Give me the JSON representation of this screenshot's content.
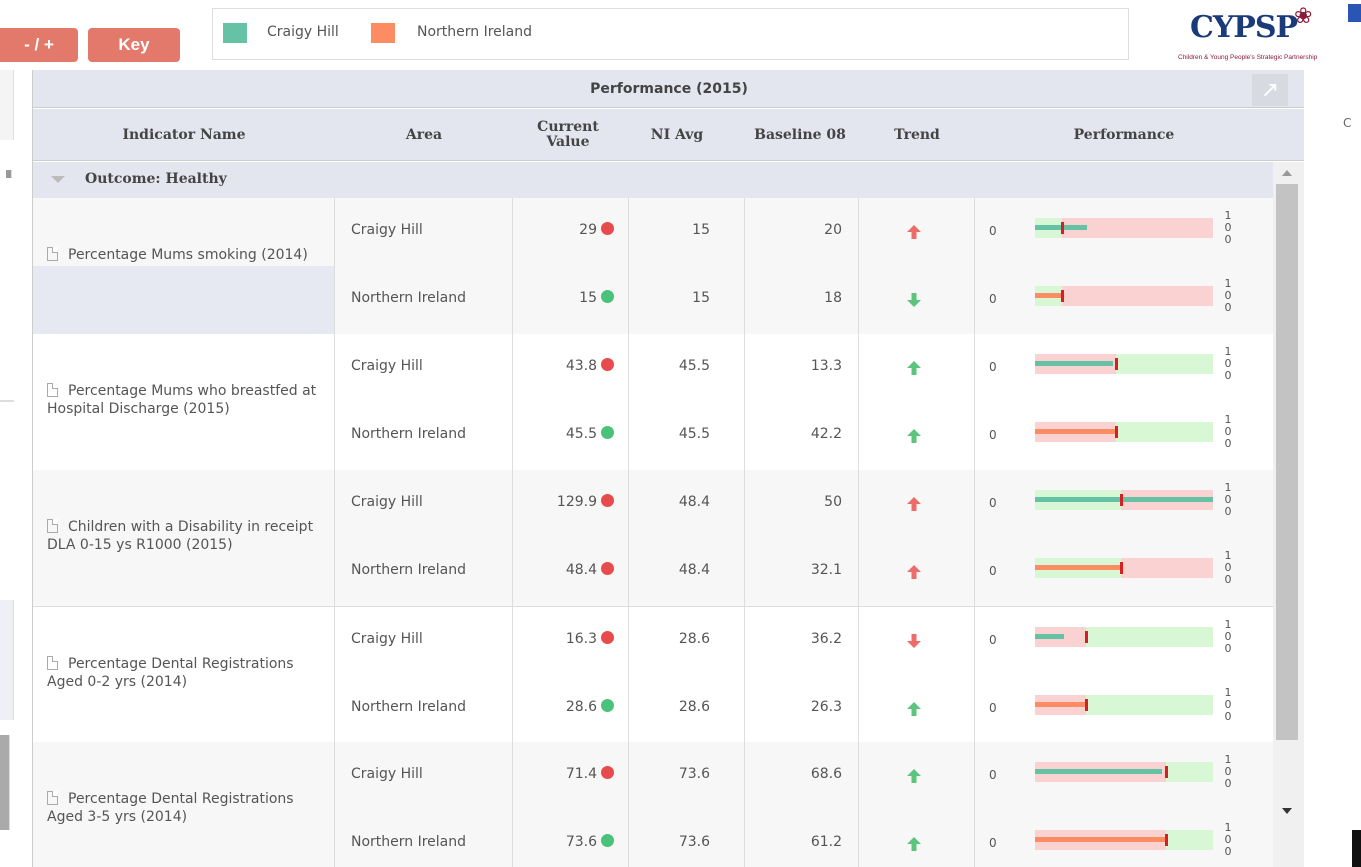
{
  "toolbar": {
    "zoom_label": "- / +",
    "key_label": "Key"
  },
  "legend": [
    {
      "label": "Craigy Hill",
      "color": "#66c2a5"
    },
    {
      "label": "Northern Ireland",
      "color": "#fc8d62"
    }
  ],
  "logo": {
    "text": "CYPSP",
    "subtitle": "Children & Young People's Strategic Partnership"
  },
  "window": {
    "title": "Performance (2015)",
    "columns": [
      "Indicator Name",
      "Area",
      "Current Value",
      "NI Avg",
      "Baseline 08",
      "Trend",
      "Performance"
    ],
    "group": "Outcome: Healthy"
  },
  "colors": {
    "good": "#4ac27a",
    "bad": "#e84b4b",
    "up_good": "#5cc47d",
    "up_bad": "#ec6b6b",
    "band_bad": "#fbd2d2",
    "band_good": "#d8f7d5",
    "marker": "#d42020"
  },
  "axis": {
    "min": "0",
    "max_digits": [
      "1",
      "0",
      "0"
    ]
  },
  "indicators": [
    {
      "name": "Percentage Mums smoking (2014)",
      "rows": [
        {
          "area": "Craigy Hill",
          "current": "29",
          "status": "bad",
          "ni_avg": "15",
          "baseline": "20",
          "trend": "up",
          "trend_color": "bad",
          "value": 29,
          "target": 15,
          "band": "lower_better"
        },
        {
          "area": "Northern Ireland",
          "current": "15",
          "status": "good",
          "ni_avg": "15",
          "baseline": "18",
          "trend": "down",
          "trend_color": "good",
          "value": 15,
          "target": 15,
          "band": "lower_better"
        }
      ]
    },
    {
      "name": "Percentage Mums who breastfed at Hospital Discharge (2015)",
      "rows": [
        {
          "area": "Craigy Hill",
          "current": "43.8",
          "status": "bad",
          "ni_avg": "45.5",
          "baseline": "13.3",
          "trend": "up",
          "trend_color": "good",
          "value": 43.8,
          "target": 45.5,
          "band": "higher_better"
        },
        {
          "area": "Northern Ireland",
          "current": "45.5",
          "status": "good",
          "ni_avg": "45.5",
          "baseline": "42.2",
          "trend": "up",
          "trend_color": "good",
          "value": 45.5,
          "target": 45.5,
          "band": "higher_better"
        }
      ]
    },
    {
      "name": "Children with a Disability in receipt DLA 0-15 ys R1000 (2015)",
      "rows": [
        {
          "area": "Craigy Hill",
          "current": "129.9",
          "status": "bad",
          "ni_avg": "48.4",
          "baseline": "50",
          "trend": "up",
          "trend_color": "bad",
          "value": 129.9,
          "target": 48.4,
          "band": "lower_better"
        },
        {
          "area": "Northern Ireland",
          "current": "48.4",
          "status": "bad",
          "ni_avg": "48.4",
          "baseline": "32.1",
          "trend": "up",
          "trend_color": "bad",
          "value": 48.4,
          "target": 48.4,
          "band": "lower_better"
        }
      ]
    },
    {
      "name": "Percentage Dental Registrations Aged 0-2 yrs (2014)",
      "rows": [
        {
          "area": "Craigy Hill",
          "current": "16.3",
          "status": "bad",
          "ni_avg": "28.6",
          "baseline": "36.2",
          "trend": "down",
          "trend_color": "bad",
          "value": 16.3,
          "target": 28.6,
          "band": "higher_better"
        },
        {
          "area": "Northern Ireland",
          "current": "28.6",
          "status": "good",
          "ni_avg": "28.6",
          "baseline": "26.3",
          "trend": "up",
          "trend_color": "good",
          "value": 28.6,
          "target": 28.6,
          "band": "higher_better"
        }
      ]
    },
    {
      "name": "Percentage Dental Registrations Aged 3-5 yrs (2014)",
      "rows": [
        {
          "area": "Craigy Hill",
          "current": "71.4",
          "status": "bad",
          "ni_avg": "73.6",
          "baseline": "68.6",
          "trend": "up",
          "trend_color": "good",
          "value": 71.4,
          "target": 73.6,
          "band": "higher_better"
        },
        {
          "area": "Northern Ireland",
          "current": "73.6",
          "status": "good",
          "ni_avg": "73.6",
          "baseline": "61.2",
          "trend": "up",
          "trend_color": "good",
          "value": 73.6,
          "target": 73.6,
          "band": "higher_better"
        }
      ]
    }
  ]
}
